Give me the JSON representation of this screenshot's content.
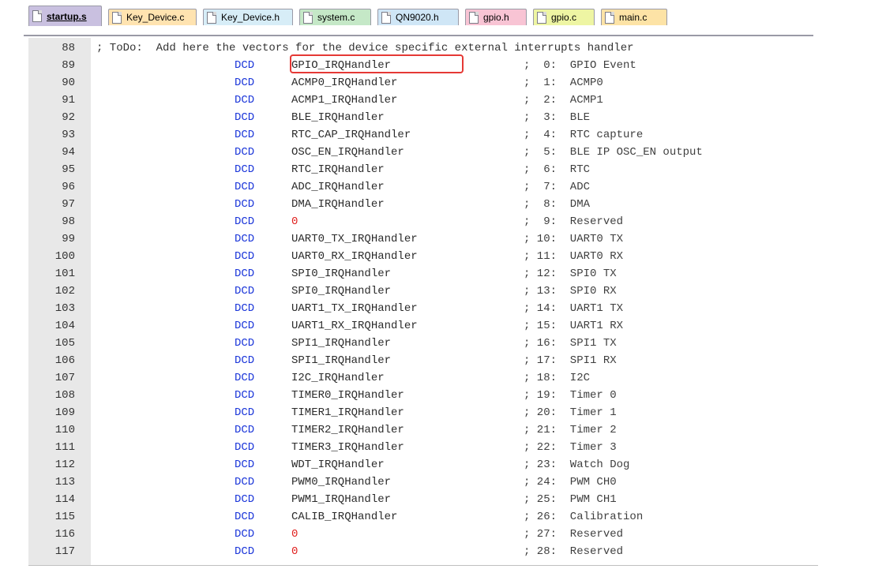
{
  "tabs": [
    {
      "label": "startup.s",
      "active": true,
      "color": "#c9c0e0"
    },
    {
      "label": "Key_Device.c",
      "active": false,
      "color": "#ffe3b0"
    },
    {
      "label": "Key_Device.h",
      "active": false,
      "color": "#d7edf7"
    },
    {
      "label": "system.c",
      "active": false,
      "color": "#c5e8c7"
    },
    {
      "label": "QN9020.h",
      "active": false,
      "color": "#cfe6f6"
    },
    {
      "label": "gpio.h",
      "active": false,
      "color": "#f8c4d4"
    },
    {
      "label": "gpio.c",
      "active": false,
      "color": "#eef5a3"
    },
    {
      "label": "main.c",
      "active": false,
      "color": "#fde3a6"
    }
  ],
  "colors": {
    "directive": "#1a35d9",
    "literal": "#e0201e",
    "highlight_box": "#e53935",
    "gutter": "#e8e8e8"
  },
  "editor": {
    "comment_line": {
      "number": "88",
      "text": "; ToDo:  Add here the vectors for the device specific external interrupts handler"
    },
    "lines": [
      {
        "number": "89",
        "directive": "DCD",
        "handler": "GPIO_IRQHandler",
        "comment": ";  0:  GPIO Event"
      },
      {
        "number": "90",
        "directive": "DCD",
        "handler": "ACMP0_IRQHandler",
        "comment": ";  1:  ACMP0"
      },
      {
        "number": "91",
        "directive": "DCD",
        "handler": "ACMP1_IRQHandler",
        "comment": ";  2:  ACMP1"
      },
      {
        "number": "92",
        "directive": "DCD",
        "handler": "BLE_IRQHandler",
        "comment": ";  3:  BLE"
      },
      {
        "number": "93",
        "directive": "DCD",
        "handler": "RTC_CAP_IRQHandler",
        "comment": ";  4:  RTC capture"
      },
      {
        "number": "94",
        "directive": "DCD",
        "handler": "OSC_EN_IRQHandler",
        "comment": ";  5:  BLE IP OSC_EN output"
      },
      {
        "number": "95",
        "directive": "DCD",
        "handler": "RTC_IRQHandler",
        "comment": ";  6:  RTC"
      },
      {
        "number": "96",
        "directive": "DCD",
        "handler": "ADC_IRQHandler",
        "comment": ";  7:  ADC"
      },
      {
        "number": "97",
        "directive": "DCD",
        "handler": "DMA_IRQHandler",
        "comment": ";  8:  DMA"
      },
      {
        "number": "98",
        "directive": "DCD",
        "handler": "0",
        "comment": ";  9:  Reserved"
      },
      {
        "number": "99",
        "directive": "DCD",
        "handler": "UART0_TX_IRQHandler",
        "comment": "; 10:  UART0 TX"
      },
      {
        "number": "100",
        "directive": "DCD",
        "handler": "UART0_RX_IRQHandler",
        "comment": "; 11:  UART0 RX"
      },
      {
        "number": "101",
        "directive": "DCD",
        "handler": "SPI0_IRQHandler",
        "comment": "; 12:  SPI0 TX"
      },
      {
        "number": "102",
        "directive": "DCD",
        "handler": "SPI0_IRQHandler",
        "comment": "; 13:  SPI0 RX"
      },
      {
        "number": "103",
        "directive": "DCD",
        "handler": "UART1_TX_IRQHandler",
        "comment": "; 14:  UART1 TX"
      },
      {
        "number": "104",
        "directive": "DCD",
        "handler": "UART1_RX_IRQHandler",
        "comment": "; 15:  UART1 RX"
      },
      {
        "number": "105",
        "directive": "DCD",
        "handler": "SPI1_IRQHandler",
        "comment": "; 16:  SPI1 TX"
      },
      {
        "number": "106",
        "directive": "DCD",
        "handler": "SPI1_IRQHandler",
        "comment": "; 17:  SPI1 RX"
      },
      {
        "number": "107",
        "directive": "DCD",
        "handler": "I2C_IRQHandler",
        "comment": "; 18:  I2C"
      },
      {
        "number": "108",
        "directive": "DCD",
        "handler": "TIMER0_IRQHandler",
        "comment": "; 19:  Timer 0"
      },
      {
        "number": "109",
        "directive": "DCD",
        "handler": "TIMER1_IRQHandler",
        "comment": "; 20:  Timer 1"
      },
      {
        "number": "110",
        "directive": "DCD",
        "handler": "TIMER2_IRQHandler",
        "comment": "; 21:  Timer 2"
      },
      {
        "number": "111",
        "directive": "DCD",
        "handler": "TIMER3_IRQHandler",
        "comment": "; 22:  Timer 3"
      },
      {
        "number": "112",
        "directive": "DCD",
        "handler": "WDT_IRQHandler",
        "comment": "; 23:  Watch Dog"
      },
      {
        "number": "113",
        "directive": "DCD",
        "handler": "PWM0_IRQHandler",
        "comment": "; 24:  PWM CH0"
      },
      {
        "number": "114",
        "directive": "DCD",
        "handler": "PWM1_IRQHandler",
        "comment": "; 25:  PWM CH1"
      },
      {
        "number": "115",
        "directive": "DCD",
        "handler": "CALIB_IRQHandler",
        "comment": "; 26:  Calibration"
      },
      {
        "number": "116",
        "directive": "DCD",
        "handler": "0",
        "comment": "; 27:  Reserved"
      },
      {
        "number": "117",
        "directive": "DCD",
        "handler": "0",
        "comment": "; 28:  Reserved"
      }
    ]
  }
}
